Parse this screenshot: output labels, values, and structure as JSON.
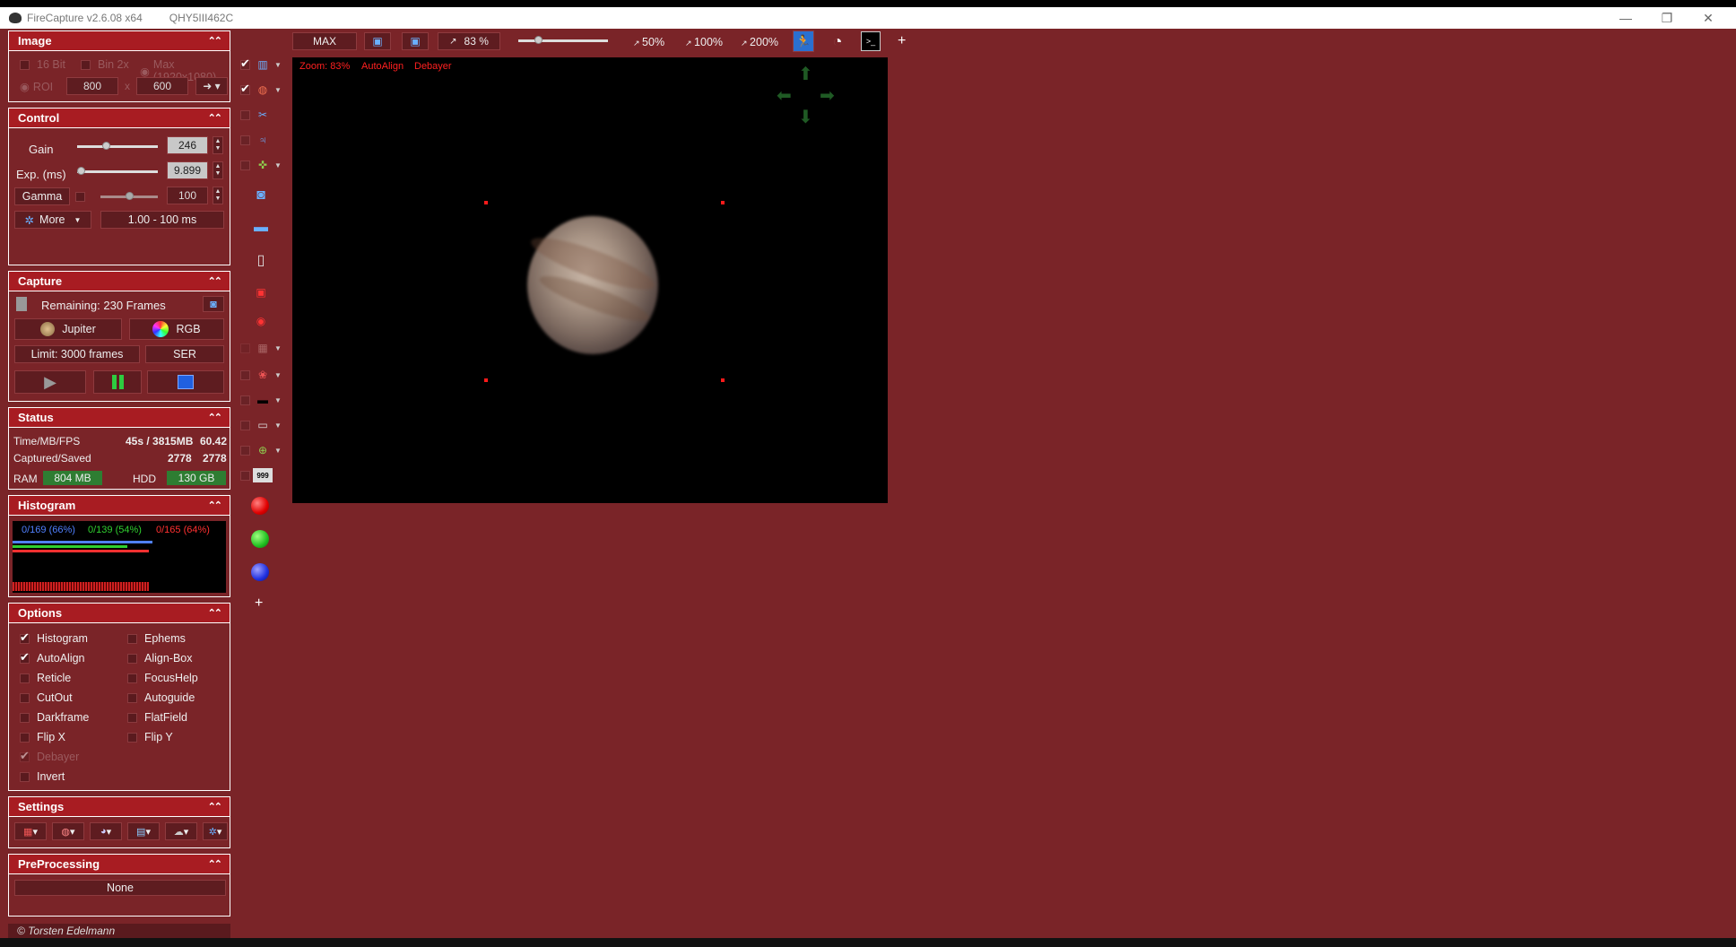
{
  "window": {
    "title": "FireCapture v2.6.08  x64",
    "camera": "QHY5III462C",
    "minimize": "—",
    "maximize": "❐",
    "close": "✕"
  },
  "toolbar": {
    "max": "MAX",
    "zoom_value": "83 %",
    "zoom_50": "50%",
    "zoom_100": "100%",
    "zoom_200": "200%",
    "add": "+"
  },
  "overlay": {
    "zoom": "Zoom: 83%",
    "autoalign": "AutoAlign",
    "debayer": "Debayer"
  },
  "image_panel": {
    "title": "Image",
    "bit16": "16 Bit",
    "bin": "Bin 2x",
    "max": "Max (1920x1080)",
    "roi": "ROI",
    "roi_w": "800",
    "x": "x",
    "roi_h": "600"
  },
  "control": {
    "title": "Control",
    "gain_label": "Gain",
    "gain_value": "246",
    "gain_level": 0.36,
    "exp_label": "Exp. (ms)",
    "exp_value": "9.899",
    "exp_level": 0.04,
    "gamma_label": "Gamma",
    "gamma_value": "100",
    "gamma_level": 0.5,
    "more": "More",
    "range": "1.00 - 100 ms"
  },
  "capture": {
    "title": "Capture",
    "remaining": "Remaining:  230 Frames",
    "profile": "Jupiter",
    "color": "RGB",
    "limit": "Limit: 3000 frames",
    "format": "SER"
  },
  "status": {
    "title": "Status",
    "time_label": "Time/MB/FPS",
    "time_value": "45s / 3815MB",
    "fps": "60.42",
    "captured_label": "Captured/Saved",
    "captured": "2778",
    "saved": "2778",
    "ram_label": "RAM",
    "ram_value": "804 MB",
    "hdd_label": "HDD",
    "hdd_value": "130 GB"
  },
  "histogram": {
    "title": "Histogram",
    "blue": "0/169 (66%)",
    "green": "0/139 (54%)",
    "red": "0/165 (64%)",
    "colors": {
      "blue": "#5080ff",
      "green": "#30d030",
      "red": "#ff3030"
    }
  },
  "options": {
    "title": "Options",
    "left": [
      {
        "label": "Histogram",
        "checked": true
      },
      {
        "label": "AutoAlign",
        "checked": true
      },
      {
        "label": "Reticle",
        "checked": false
      },
      {
        "label": "CutOut",
        "checked": false
      },
      {
        "label": "Darkframe",
        "checked": false
      },
      {
        "label": "Flip X",
        "checked": false
      },
      {
        "label": "Debayer",
        "checked": true
      },
      {
        "label": "Invert",
        "checked": false
      }
    ],
    "right": [
      {
        "label": "Ephems",
        "checked": false
      },
      {
        "label": "Align-Box",
        "checked": false
      },
      {
        "label": "FocusHelp",
        "checked": false
      },
      {
        "label": "Autoguide",
        "checked": false
      },
      {
        "label": "FlatField",
        "checked": false
      },
      {
        "label": "Flip Y",
        "checked": false
      }
    ]
  },
  "settings": {
    "title": "Settings"
  },
  "preprocessing": {
    "title": "PreProcessing",
    "value": "None"
  },
  "footer": {
    "copyright": "© Torsten Edelmann"
  },
  "tools": {
    "add": "+",
    "counter": "999"
  },
  "colors": {
    "background": "#7a2428",
    "panel_header": "#a81c22"
  }
}
